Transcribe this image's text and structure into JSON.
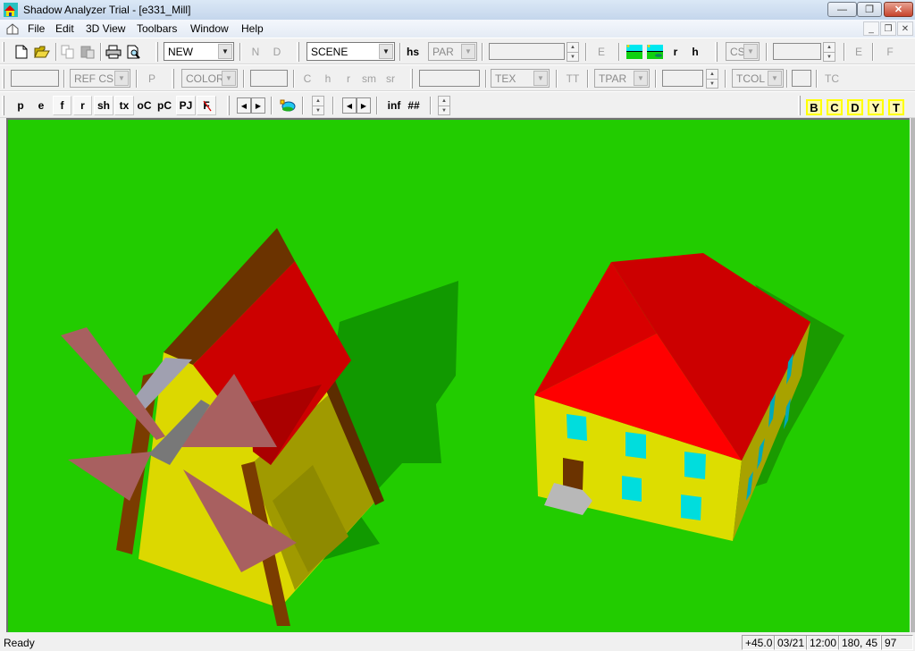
{
  "window": {
    "title": "Shadow Analyzer Trial - [e331_Mill]",
    "controls": {
      "minimize": "—",
      "restore": "❐",
      "close": "✕"
    },
    "mdi_controls": {
      "minimize": "_",
      "restore": "❐",
      "close": "✕"
    }
  },
  "menu": {
    "items": [
      "File",
      "Edit",
      "3D View",
      "Toolbars",
      "Window",
      "Help"
    ]
  },
  "toolbar1": {
    "icons": [
      "new-document-icon",
      "open-folder-icon",
      "copy-icon",
      "paste-icon",
      "print-icon",
      "print-preview-icon"
    ],
    "object_combo": "NEW",
    "n_label": "N",
    "d_label": "D",
    "scene_combo": "SCENE",
    "hs_label": "hs",
    "par_combo": "PAR",
    "e_label": "E",
    "r_label": "r",
    "h_label": "h",
    "cs_combo": "CS",
    "e2_label": "E",
    "f_label": "F"
  },
  "toolbar2": {
    "refcs_combo": "REF CS",
    "p_label": "P",
    "color_combo": "COLOR",
    "c_label": "C",
    "h_label": "h",
    "r_label": "r",
    "sm_label": "sm",
    "sr_label": "sr",
    "tex_combo": "TEX",
    "tt_label": "TT",
    "tpar_combo": "TPAR",
    "tcol_combo": "TCOL",
    "tc_label": "TC"
  },
  "toolbar3": {
    "view_buttons": [
      "p",
      "e",
      "f",
      "r",
      "sh",
      "tx",
      "oC",
      "pC",
      "PJ",
      "F"
    ],
    "inf_label": "inf",
    "hash_label": "##",
    "letter_buttons": [
      "B",
      "C",
      "D",
      "Y",
      "T"
    ]
  },
  "scene": {
    "name": "e331_Mill",
    "objects": [
      "windmill",
      "house"
    ],
    "colors": {
      "ground": "#22cc00",
      "shadow": "#119900",
      "roof": "#cc0000",
      "roof_lit": "#ff0000",
      "wall": "#dddd00",
      "wall_shade": "#a09a00",
      "wood": "#6b3300",
      "sail": "#a86060",
      "window": "#00dddd",
      "step": "#b8b8b8",
      "axle": "#787878"
    }
  },
  "status": {
    "message": "Ready",
    "angle": "+45.0",
    "date": "03/21",
    "time": "12:00",
    "sun_pos": "180, 45",
    "value": "97"
  }
}
